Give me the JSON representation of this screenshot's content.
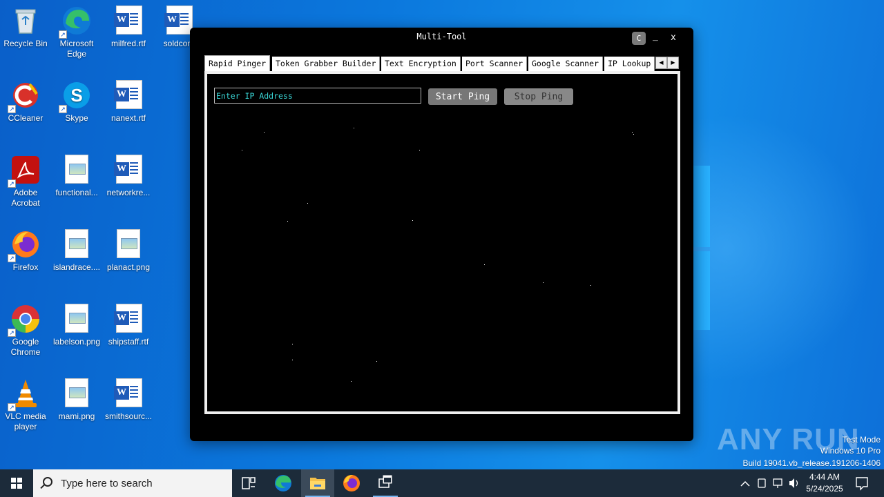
{
  "desktop": {
    "icons": [
      {
        "label": "Recycle Bin"
      },
      {
        "label": "Microsoft Edge"
      },
      {
        "label": "milfred.rtf"
      },
      {
        "label": "soldcom"
      },
      {
        "label": "CCleaner"
      },
      {
        "label": "Skype"
      },
      {
        "label": "nanext.rtf"
      },
      {
        "label": "Adobe Acrobat"
      },
      {
        "label": "functional..."
      },
      {
        "label": "networkre..."
      },
      {
        "label": "Firefox"
      },
      {
        "label": "islandrace...."
      },
      {
        "label": "planact.png"
      },
      {
        "label": "Google Chrome"
      },
      {
        "label": "labelson.png"
      },
      {
        "label": "shipstaff.rtf"
      },
      {
        "label": "VLC media player"
      },
      {
        "label": "mami.png"
      },
      {
        "label": "smithsourc..."
      }
    ]
  },
  "window": {
    "title": "Multi-Tool",
    "btn_c": "C",
    "btn_min": "_",
    "btn_close": "x",
    "tabs": [
      {
        "label": "Rapid Pinger"
      },
      {
        "label": "Token Grabber Builder"
      },
      {
        "label": "Text Encryption"
      },
      {
        "label": "Port Scanner"
      },
      {
        "label": "Google Scanner"
      },
      {
        "label": "IP Lookup"
      }
    ],
    "panel": {
      "ip_placeholder": "Enter IP Address",
      "start_label": "Start Ping",
      "stop_label": "Stop Ping"
    }
  },
  "taskbar": {
    "search_placeholder": "Type here to search",
    "time": "4:44 AM",
    "date": "5/24/2025"
  },
  "watermark": {
    "line1": "Test Mode",
    "line2": "Windows 10 Pro",
    "line3": "Build 19041.vb_release.191206-1406",
    "brand": "ANY RUN"
  }
}
